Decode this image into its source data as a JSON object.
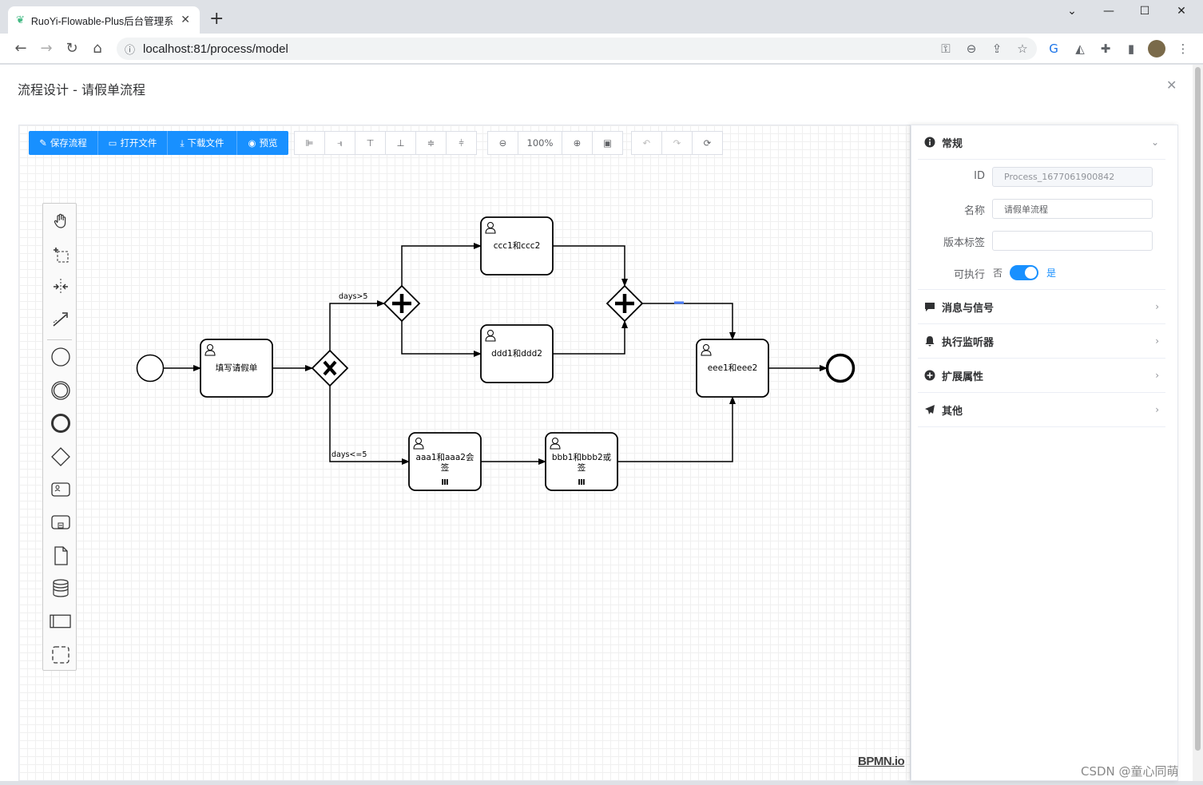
{
  "browser": {
    "tab_title": "RuoYi-Flowable-Plus后台管理系统",
    "tab_close": "✕",
    "new_tab": "+",
    "url": "localhost:81/process/model",
    "win_min": "—",
    "win_max": "☐",
    "win_close": "✕",
    "win_dropdown": "⌄"
  },
  "dialog": {
    "title": "流程设计 - 请假单流程",
    "close": "✕"
  },
  "toolbar": {
    "save": "保存流程",
    "open": "打开文件",
    "download": "下载文件",
    "preview": "预览",
    "zoom": "100%"
  },
  "diagram": {
    "task_fill": "填写请假单",
    "task_ccc": "ccc1和ccc2",
    "task_ddd": "ddd1和ddd2",
    "task_aaa": "aaa1和aaa2会签",
    "task_aaa_l1": "aaa1和aaa2会",
    "task_aaa_l2": "签",
    "task_bbb": "bbb1和bbb2或签",
    "task_bbb_l1": "bbb1和bbb2或",
    "task_bbb_l2": "签",
    "task_eee": "eee1和eee2",
    "cond_gt": "days>5",
    "cond_le": "days<=5",
    "multi": "Ⅲ"
  },
  "panel": {
    "general": "常规",
    "id_label": "ID",
    "id_value": "Process_1677061900842",
    "name_label": "名称",
    "name_value": "请假单流程",
    "version_label": "版本标签",
    "version_value": "",
    "exec_label": "可执行",
    "exec_no": "否",
    "exec_yes": "是",
    "msg": "消息与信号",
    "listener": "执行监听器",
    "ext": "扩展属性",
    "other": "其他"
  },
  "brand": "BPMN.io",
  "watermark": "CSDN @童心同萌",
  "colors": {
    "primary": "#1890ff"
  }
}
